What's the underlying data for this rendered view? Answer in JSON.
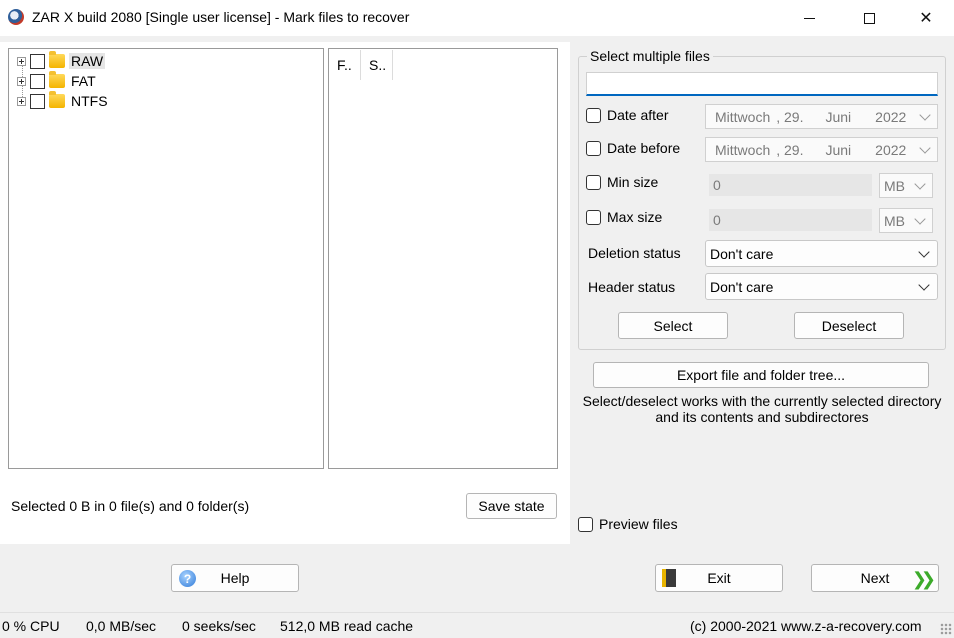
{
  "window": {
    "title": "ZAR X build 2080 [Single user license] - Mark files to recover",
    "icon": "zar-app-icon"
  },
  "tree": {
    "items": [
      {
        "label": "RAW",
        "checked": false,
        "selected": true
      },
      {
        "label": "FAT",
        "checked": false,
        "selected": false
      },
      {
        "label": "NTFS",
        "checked": false,
        "selected": false
      }
    ]
  },
  "file_list": {
    "columns": [
      "F..",
      "S.."
    ]
  },
  "selection_status": "Selected 0 B in 0 file(s) and 0 folder(s)",
  "save_state_label": "Save state",
  "filter": {
    "group_title": "Select multiple files",
    "mask_value": "",
    "date_after": {
      "label": "Date after",
      "checked": false,
      "day_name": "Mittwoch",
      "day": ", 29.",
      "month": "Juni",
      "year": "2022"
    },
    "date_before": {
      "label": "Date before",
      "checked": false,
      "day_name": "Mittwoch",
      "day": ", 29.",
      "month": "Juni",
      "year": "2022"
    },
    "min_size": {
      "label": "Min size",
      "checked": false,
      "value": "0",
      "unit": "MB"
    },
    "max_size": {
      "label": "Max size",
      "checked": false,
      "value": "0",
      "unit": "MB"
    },
    "deletion_status": {
      "label": "Deletion status",
      "value": "Don't care"
    },
    "header_status": {
      "label": "Header status",
      "value": "Don't care"
    },
    "select_label": "Select",
    "deselect_label": "Deselect"
  },
  "export_label": "Export file and folder tree...",
  "info_line1": "Select/deselect works with the currently selected directory",
  "info_line2": "and its contents and subdirectores",
  "preview_files": {
    "label": "Preview files",
    "checked": false
  },
  "bottom": {
    "help_label": "Help",
    "exit_label": "Exit",
    "next_label": "Next"
  },
  "statusbar": {
    "cpu": "0 % CPU",
    "rate": "0,0 MB/sec",
    "seeks": "0 seeks/sec",
    "cache": "512,0 MB read cache",
    "copyright": "(c) 2000-2021 www.z-a-recovery.com"
  },
  "colors": {
    "accent": "#0067c0",
    "folder": "#f4b400",
    "next_arrow": "#3cab2a"
  }
}
